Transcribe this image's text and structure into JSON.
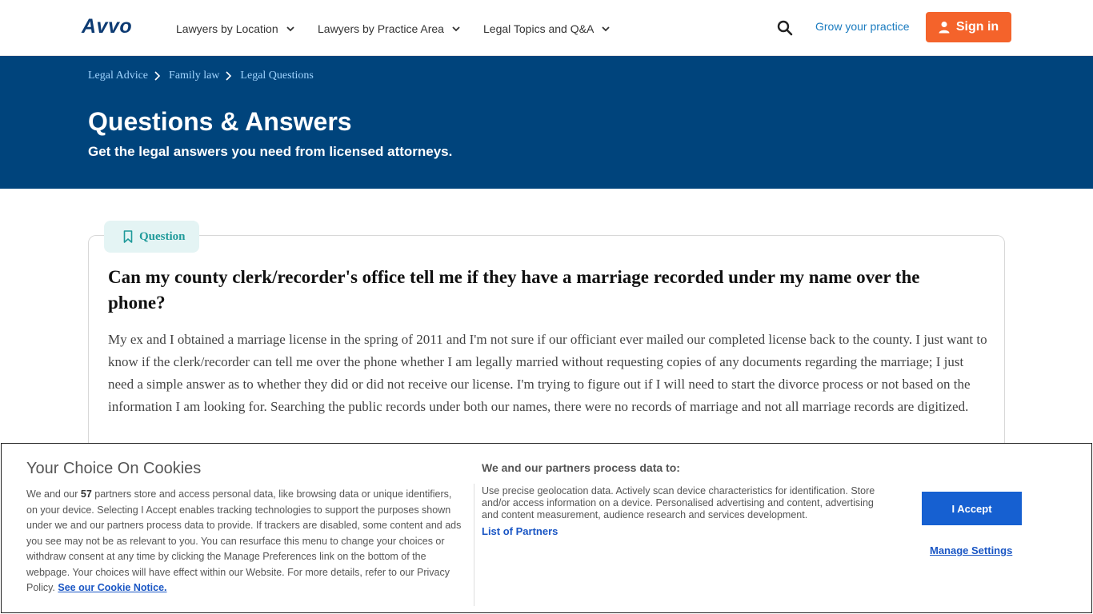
{
  "header": {
    "logo_text": "Avvo",
    "nav": [
      {
        "label": "Lawyers by Location"
      },
      {
        "label": "Lawyers by Practice Area"
      },
      {
        "label": "Legal Topics and Q&A"
      }
    ],
    "grow_label": "Grow your practice",
    "signin_label": "Sign in",
    "signin_color": "#f4632b",
    "search_icon": "search-icon"
  },
  "hero": {
    "breadcrumbs": [
      "Legal Advice",
      "Family law",
      "Legal Questions"
    ],
    "title": "Questions & Answers",
    "subtitle": "Get the legal answers you need from licensed attorneys.",
    "background": "#00447c"
  },
  "question": {
    "tag": "Question",
    "title": "Can my county clerk/recorder's office tell me if they have a marriage recorded under my name over the phone?",
    "body": "My ex and I obtained a marriage license in the spring of 2011 and I'm not sure if our officiant ever mailed our completed license back to the county. I just want to know if the clerk/recorder can tell me over the phone whether I am legally married without requesting copies of any documents regarding the marriage; I just need a simple answer as to whether they did or did not receive our license. I'm trying to figure out if I will need to start the divorce process or not based on the information I am looking for. Searching the public records under both our names, there were no records of marriage and not all marriage records are digitized."
  },
  "cookie": {
    "title": "Your Choice On Cookies",
    "text_before": "We and our ",
    "partner_count": "57",
    "text_after": " partners store and access personal data, like browsing data or unique identifiers, on your device. Selecting I Accept enables tracking technologies to support the purposes shown under we and our partners process data to provide. If trackers are disabled, some content and ads you see may not be as relevant to you. You can resurface this menu to change your choices or withdraw consent at any time by clicking the Manage Preferences link on the bottom of the webpage. Your choices will have effect within our Website. For more details, refer to our Privacy Policy. ",
    "notice_link": "See our Cookie Notice.",
    "right_title": "We and our partners process data to:",
    "purposes": "Use precise geolocation data. Actively scan device characteristics for identification. Store and/or access information on a device. Personalised advertising and content, advertising and content measurement, audience research and services development.",
    "partners_link": "List of Partners",
    "accept_label": "I Accept",
    "manage_label": "Manage Settings",
    "accept_color": "#1660d1"
  }
}
